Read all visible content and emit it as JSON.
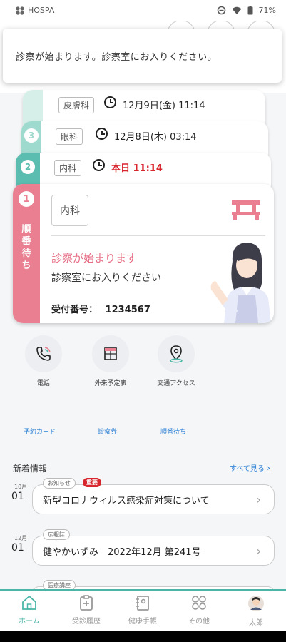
{
  "status_bar": {
    "app_name": "HOSPA",
    "battery": "71%"
  },
  "notification": {
    "text": "診察が始まります。診察室にお入りください。"
  },
  "queue_cards": [
    {
      "number": "",
      "department": "皮膚科",
      "datetime": "12月9日(金) 11:14",
      "color": "#d7efe9"
    },
    {
      "number": "3",
      "department": "眼科",
      "datetime": "12月8日(木) 03:14",
      "color": "#9fdacf"
    },
    {
      "number": "2",
      "department": "内科",
      "datetime": "本日 11:14",
      "color": "#5bbdaf",
      "highlight_color": "#d8262e"
    }
  ],
  "main_card": {
    "number": "1",
    "status": "順番待ち",
    "department": "内科",
    "message": "診察が始まります",
    "sub_message": "診察室にお入りください",
    "receipt_label": "受付番号：",
    "receipt_number": "1234567",
    "accent_color": "#e97f91"
  },
  "quick_actions": [
    {
      "label": "電話",
      "icon": "phone-icon"
    },
    {
      "label": "外来予定表",
      "icon": "calendar-icon"
    },
    {
      "label": "交通アクセス",
      "icon": "location-pin-icon"
    }
  ],
  "tab_links": [
    "予約カード",
    "診察券",
    "順番待ち"
  ],
  "news": {
    "title": "新着情報",
    "see_all": "すべて見る",
    "items": [
      {
        "month": "10月",
        "day": "01",
        "tag": "お知らせ",
        "important": "重要",
        "text": "新型コロナウィルス感染症対策について"
      },
      {
        "month": "12月",
        "day": "01",
        "tag": "広報誌",
        "text": "健やかいずみ　2022年12月 第241号"
      },
      {
        "month": "",
        "day": "",
        "tag": "医療講座",
        "text": ""
      }
    ]
  },
  "bottom_nav": [
    {
      "label": "ホーム",
      "icon": "home-icon",
      "active": true
    },
    {
      "label": "受診履歴",
      "icon": "clipboard-plus-icon",
      "active": false
    },
    {
      "label": "健康手帳",
      "icon": "notebook-icon",
      "active": false
    },
    {
      "label": "その他",
      "icon": "grid-circles-icon",
      "active": false
    },
    {
      "label": "太郎",
      "icon": "avatar",
      "active": false
    }
  ],
  "colors": {
    "accent": "#4bb6a7",
    "link": "#2a7fd4",
    "pink": "#e97f91",
    "red": "#d8262e"
  }
}
